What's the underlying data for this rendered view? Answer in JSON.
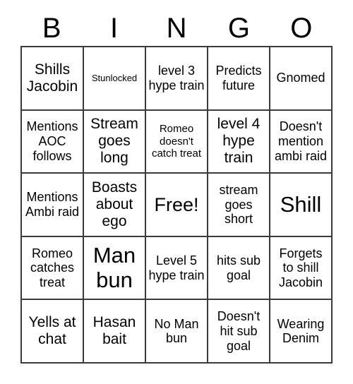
{
  "card": {
    "title": "BINGO",
    "header_letters": [
      "B",
      "I",
      "N",
      "G",
      "O"
    ],
    "colors": {
      "grid_line": "#3b3b3b",
      "text": "#000000",
      "background": "#ffffff"
    },
    "grid_size": "5x5",
    "free_space": "Free!",
    "rows": [
      [
        {
          "text": "Shills Jacobin",
          "size": "lg"
        },
        {
          "text": "Stunlocked",
          "size": "xs"
        },
        {
          "text": "level 3 hype train",
          "size": "md"
        },
        {
          "text": "Predicts future",
          "size": "md"
        },
        {
          "text": "Gnomed",
          "size": "md"
        }
      ],
      [
        {
          "text": "Mentions AOC follows",
          "size": "md"
        },
        {
          "text": "Stream goes long",
          "size": "lg"
        },
        {
          "text": "Romeo doesn't catch treat",
          "size": "sm"
        },
        {
          "text": "level 4 hype train",
          "size": "lg"
        },
        {
          "text": "Doesn't mention ambi raid",
          "size": "md"
        }
      ],
      [
        {
          "text": "Mentions Ambi raid",
          "size": "md"
        },
        {
          "text": "Boasts about ego",
          "size": "lg"
        },
        {
          "text": "Free!",
          "size": "xl"
        },
        {
          "text": "stream goes short",
          "size": "md"
        },
        {
          "text": "Shill",
          "size": "xxl"
        }
      ],
      [
        {
          "text": "Romeo catches treat",
          "size": "md"
        },
        {
          "text": "Man bun",
          "size": "xxl"
        },
        {
          "text": "Level 5 hype train",
          "size": "md"
        },
        {
          "text": "hits sub goal",
          "size": "md"
        },
        {
          "text": "Forgets to shill Jacobin",
          "size": "md"
        }
      ],
      [
        {
          "text": "Yells at chat",
          "size": "lg"
        },
        {
          "text": "Hasan bait",
          "size": "lg"
        },
        {
          "text": "No Man bun",
          "size": "md"
        },
        {
          "text": "Doesn't hit sub goal",
          "size": "md"
        },
        {
          "text": "Wearing Denim",
          "size": "md"
        }
      ]
    ]
  }
}
